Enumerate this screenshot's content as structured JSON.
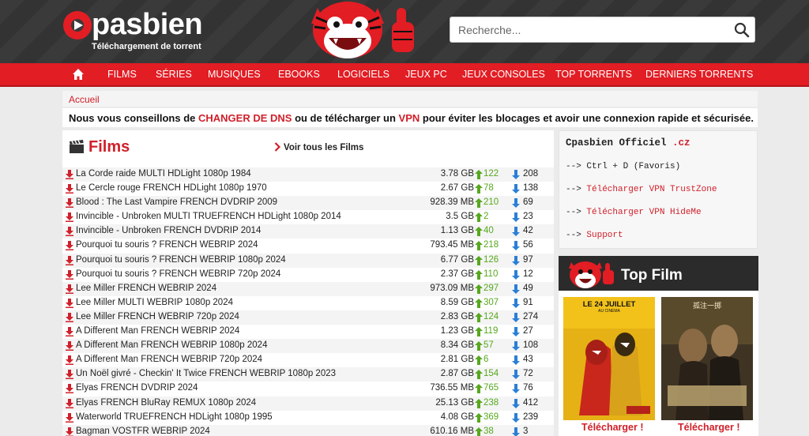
{
  "header": {
    "logo_text": "pasbien",
    "logo_subtitle": "Téléchargement de torrent",
    "search_placeholder": "Recherche..."
  },
  "nav": {
    "items": [
      "FILMS",
      "SÉRIES",
      "MUSIQUES",
      "EBOOKS",
      "LOGICIELS",
      "JEUX PC",
      "JEUX CONSOLES",
      "TOP TORRENTS",
      "DERNIERS TORRENTS"
    ]
  },
  "breadcrumb": "Accueil",
  "notice": {
    "part1": "Nous vous conseillons de ",
    "link1": "CHANGER DE DNS",
    "part2": " ou de télécharger un ",
    "link2": "VPN",
    "part3": " pour éviter les blocages et avoir une connexion rapide et sécurisée."
  },
  "films": {
    "title": "Films",
    "see_all": "Voir tous les Films",
    "rows": [
      {
        "name": "La Corde raide MULTI HDLight 1080p 1984",
        "size": "3.78 GB",
        "seeds": "122",
        "leech": "208"
      },
      {
        "name": "Le Cercle rouge FRENCH HDLight 1080p 1970",
        "size": "2.67 GB",
        "seeds": "78",
        "leech": "138"
      },
      {
        "name": "Blood : The Last Vampire FRENCH DVDRIP 2009",
        "size": "928.39 MB",
        "seeds": "210",
        "leech": "69"
      },
      {
        "name": "Invincible - Unbroken MULTI TRUEFRENCH HDLight 1080p 2014",
        "size": "3.5 GB",
        "seeds": "2",
        "leech": "23"
      },
      {
        "name": "Invincible - Unbroken FRENCH DVDRIP 2014",
        "size": "1.13 GB",
        "seeds": "40",
        "leech": "42"
      },
      {
        "name": "Pourquoi tu souris ? FRENCH WEBRIP 2024",
        "size": "793.45 MB",
        "seeds": "218",
        "leech": "56"
      },
      {
        "name": "Pourquoi tu souris ? FRENCH WEBRIP 1080p 2024",
        "size": "6.77 GB",
        "seeds": "126",
        "leech": "97"
      },
      {
        "name": "Pourquoi tu souris ? FRENCH WEBRIP 720p 2024",
        "size": "2.37 GB",
        "seeds": "110",
        "leech": "12"
      },
      {
        "name": "Lee Miller FRENCH WEBRIP 2024",
        "size": "973.09 MB",
        "seeds": "297",
        "leech": "49"
      },
      {
        "name": "Lee Miller MULTI WEBRIP 1080p 2024",
        "size": "8.59 GB",
        "seeds": "307",
        "leech": "91"
      },
      {
        "name": "Lee Miller FRENCH WEBRIP 720p 2024",
        "size": "2.83 GB",
        "seeds": "124",
        "leech": "274"
      },
      {
        "name": "A Different Man FRENCH WEBRIP 2024",
        "size": "1.23 GB",
        "seeds": "119",
        "leech": "27"
      },
      {
        "name": "A Different Man FRENCH WEBRIP 1080p 2024",
        "size": "8.34 GB",
        "seeds": "57",
        "leech": "108"
      },
      {
        "name": "A Different Man FRENCH WEBRIP 720p 2024",
        "size": "2.81 GB",
        "seeds": "6",
        "leech": "43"
      },
      {
        "name": "Un Noël givré - Checkin' It Twice FRENCH WEBRIP 1080p 2023",
        "size": "2.87 GB",
        "seeds": "154",
        "leech": "72"
      },
      {
        "name": "Elyas FRENCH DVDRIP 2024",
        "size": "736.55 MB",
        "seeds": "765",
        "leech": "76"
      },
      {
        "name": "Elyas FRENCH BluRay REMUX 1080p 2024",
        "size": "25.13 GB",
        "seeds": "238",
        "leech": "412"
      },
      {
        "name": "Waterworld TRUEFRENCH HDLight 1080p 1995",
        "size": "4.08 GB",
        "seeds": "369",
        "leech": "239"
      },
      {
        "name": "Bagman VOSTFR WEBRIP 2024",
        "size": "610.16 MB",
        "seeds": "38",
        "leech": "3"
      }
    ]
  },
  "sidebar": {
    "title": "Cpasbien Officiel",
    "title_suffix": ".cz",
    "lines": [
      {
        "prefix": "--> ",
        "text": "Ctrl + D  (Favoris)",
        "link": false
      },
      {
        "prefix": "--> ",
        "text": "Télécharger VPN TrustZone",
        "link": true
      },
      {
        "prefix": "--> ",
        "text": "Télécharger VPN HideMe",
        "link": true
      },
      {
        "prefix": "--> ",
        "text": "Support",
        "link": true
      }
    ]
  },
  "top_film": {
    "title": "Top Film",
    "posters": [
      {
        "caption": "LE 24 JUILLET",
        "sub": "AU CINÉMA",
        "download": "Télécharger !"
      },
      {
        "caption": "孤注一掷",
        "sub": "",
        "download": "Télécharger !"
      }
    ]
  },
  "colors": {
    "brand_red": "#e21d24",
    "link_red": "#d0202a",
    "seed_green": "#57a81f",
    "leech_blue": "#2a7fd6"
  }
}
